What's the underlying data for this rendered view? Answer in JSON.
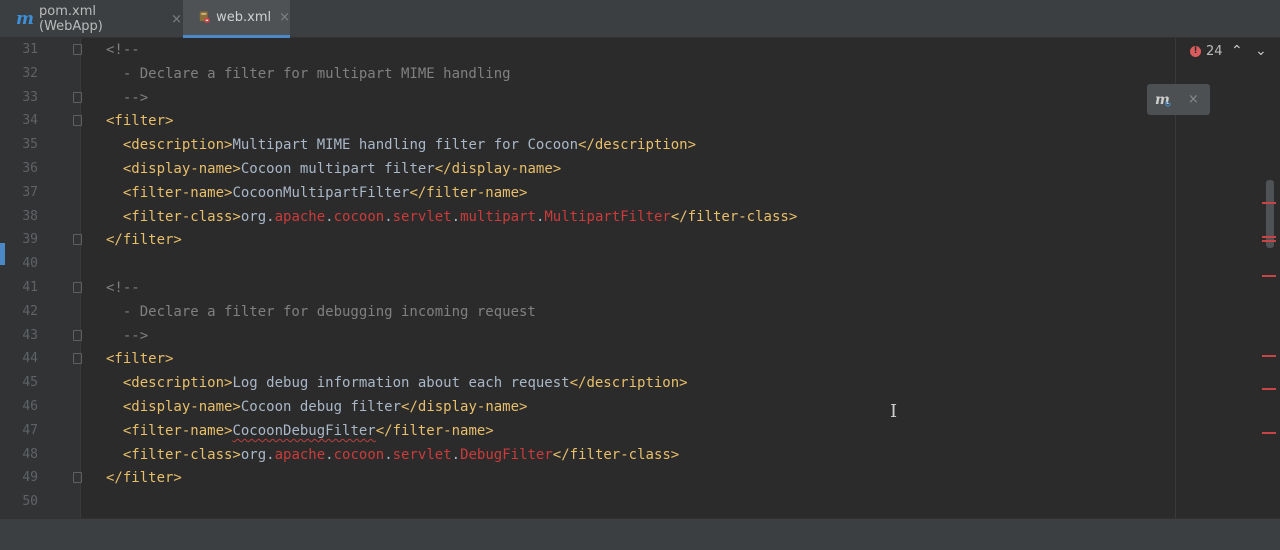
{
  "tabs": [
    {
      "icon": "maven-m-icon",
      "label": "pom.xml (WebApp)",
      "close": "×",
      "active": false
    },
    {
      "icon": "web-xml-icon",
      "label": "web.xml",
      "close": "×",
      "active": true
    }
  ],
  "inspections": {
    "error_count": "24",
    "up": "⌃",
    "down": "⌄"
  },
  "maven_popup": {
    "icon": "maven-refresh-icon",
    "close": "×"
  },
  "colors": {
    "tag": "#e8bf6a",
    "comment": "#808080",
    "text": "#a9b7c6",
    "package_error": "#cc3b3b",
    "error_stripe": "#c94545",
    "tab_accent": "#4a88c7"
  },
  "lines": [
    {
      "n": "31",
      "fold": true,
      "segs": [
        [
          "c",
          "<!--"
        ]
      ]
    },
    {
      "n": "32",
      "fold": false,
      "segs": [
        [
          "c",
          "  - Declare a filter for multipart MIME handling"
        ]
      ]
    },
    {
      "n": "33",
      "fold": true,
      "segs": [
        [
          "c",
          "  -->"
        ]
      ]
    },
    {
      "n": "34",
      "fold": true,
      "segs": [
        [
          "t",
          "<filter>"
        ]
      ]
    },
    {
      "n": "35",
      "fold": false,
      "segs": [
        [
          "x",
          "  "
        ],
        [
          "t",
          "<description>"
        ],
        [
          "x",
          "Multipart MIME handling filter for Cocoon"
        ],
        [
          "t",
          "</description>"
        ]
      ]
    },
    {
      "n": "36",
      "fold": false,
      "segs": [
        [
          "x",
          "  "
        ],
        [
          "t",
          "<display-name>"
        ],
        [
          "x",
          "Cocoon multipart filter"
        ],
        [
          "t",
          "</display-name>"
        ]
      ]
    },
    {
      "n": "37",
      "fold": false,
      "segs": [
        [
          "x",
          "  "
        ],
        [
          "t",
          "<filter-name>"
        ],
        [
          "x",
          "CocoonMultipartFilter"
        ],
        [
          "t",
          "</filter-name>"
        ]
      ]
    },
    {
      "n": "38",
      "fold": false,
      "segs": [
        [
          "x",
          "  "
        ],
        [
          "t",
          "<filter-class>"
        ],
        [
          "x",
          "org."
        ],
        [
          "p",
          "apache"
        ],
        [
          "x",
          "."
        ],
        [
          "p",
          "cocoon"
        ],
        [
          "x",
          "."
        ],
        [
          "p",
          "servlet"
        ],
        [
          "x",
          "."
        ],
        [
          "p",
          "multipart"
        ],
        [
          "x",
          "."
        ],
        [
          "p",
          "MultipartFilter"
        ],
        [
          "t",
          "</filter-class>"
        ]
      ]
    },
    {
      "n": "39",
      "fold": true,
      "segs": [
        [
          "t",
          "</filter>"
        ]
      ]
    },
    {
      "n": "40",
      "fold": false,
      "segs": []
    },
    {
      "n": "41",
      "fold": true,
      "segs": [
        [
          "c",
          "<!--"
        ]
      ]
    },
    {
      "n": "42",
      "fold": false,
      "segs": [
        [
          "c",
          "  - Declare a filter for debugging incoming request"
        ]
      ]
    },
    {
      "n": "43",
      "fold": true,
      "segs": [
        [
          "c",
          "  -->"
        ]
      ]
    },
    {
      "n": "44",
      "fold": true,
      "segs": [
        [
          "t",
          "<filter>"
        ]
      ]
    },
    {
      "n": "45",
      "fold": false,
      "segs": [
        [
          "x",
          "  "
        ],
        [
          "t",
          "<description>"
        ],
        [
          "x",
          "Log debug information about each request"
        ],
        [
          "t",
          "</description>"
        ]
      ]
    },
    {
      "n": "46",
      "fold": false,
      "segs": [
        [
          "x",
          "  "
        ],
        [
          "t",
          "<display-name>"
        ],
        [
          "x",
          "Cocoon debug filter"
        ],
        [
          "t",
          "</display-name>"
        ]
      ]
    },
    {
      "n": "47",
      "fold": false,
      "segs": [
        [
          "x",
          "  "
        ],
        [
          "t",
          "<filter-name>"
        ],
        [
          "s",
          "CocoonDebugFilter"
        ],
        [
          "t",
          "</filter-name>"
        ]
      ]
    },
    {
      "n": "48",
      "fold": false,
      "segs": [
        [
          "x",
          "  "
        ],
        [
          "t",
          "<filter-class>"
        ],
        [
          "x",
          "org."
        ],
        [
          "p",
          "apache"
        ],
        [
          "x",
          "."
        ],
        [
          "p",
          "cocoon"
        ],
        [
          "x",
          "."
        ],
        [
          "p",
          "servlet"
        ],
        [
          "x",
          "."
        ],
        [
          "p",
          "DebugFilter"
        ],
        [
          "t",
          "</filter-class>"
        ]
      ]
    },
    {
      "n": "49",
      "fold": true,
      "segs": [
        [
          "t",
          "</filter>"
        ]
      ]
    },
    {
      "n": "50",
      "fold": false,
      "segs": []
    }
  ]
}
